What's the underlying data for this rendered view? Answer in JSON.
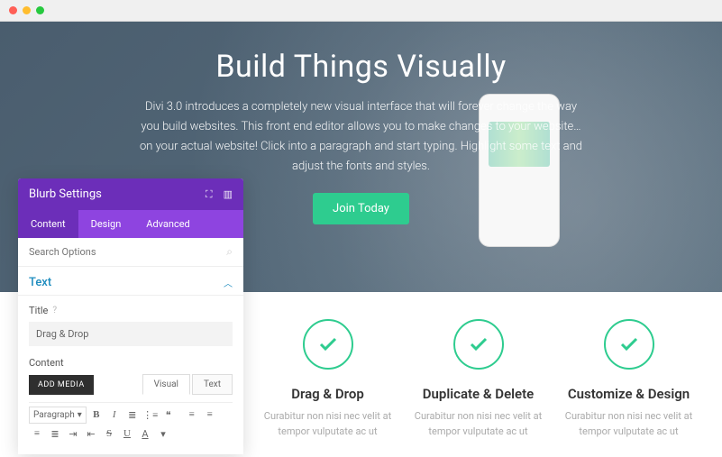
{
  "hero": {
    "title": "Build Things Visually",
    "description": "Divi 3.0 introduces a completely new visual interface that will forever change the way you build websites. This front end editor allows you to make changes to your website…on your actual website! Click into a paragraph and start typing. Highlight some text and adjust the fonts and styles.",
    "cta": "Join Today"
  },
  "panel": {
    "title": "Blurb Settings",
    "tabs": {
      "content": "Content",
      "design": "Design",
      "advanced": "Advanced"
    },
    "search_placeholder": "Search Options",
    "section": "Text",
    "title_label": "Title",
    "title_value": "Drag & Drop",
    "content_label": "Content",
    "add_media": "ADD MEDIA",
    "editor_tabs": {
      "visual": "Visual",
      "text": "Text"
    },
    "format": "Paragraph"
  },
  "features": [
    {
      "title": "Drag & Drop",
      "desc": "Curabitur non nisi nec velit at tempor vulputate ac ut"
    },
    {
      "title": "Duplicate & Delete",
      "desc": "Curabitur non nisi nec velit at tempor vulputate ac ut"
    },
    {
      "title": "Customize & Design",
      "desc": "Curabitur non nisi nec velit at tempor vulputate ac ut"
    }
  ]
}
